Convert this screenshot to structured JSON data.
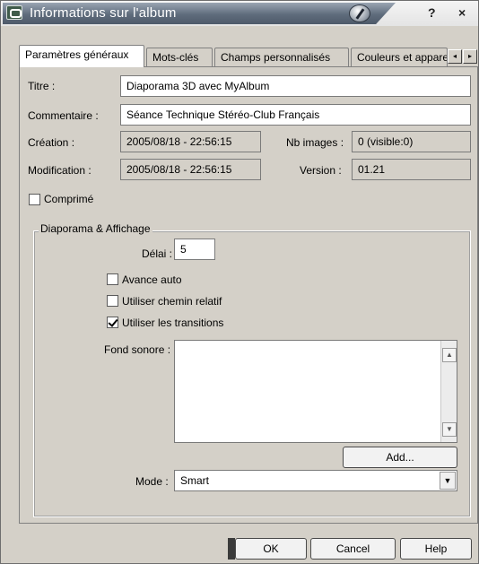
{
  "window": {
    "title": "Informations sur l'album",
    "help_glyph": "?",
    "close_glyph": "×"
  },
  "tabs": [
    {
      "label": "Paramètres généraux",
      "active": true
    },
    {
      "label": "Mots-clés",
      "active": false
    },
    {
      "label": "Champs personnalisés",
      "active": false
    },
    {
      "label": "Couleurs et apparence",
      "active": false
    }
  ],
  "tab_scroll": {
    "left_glyph": "◂",
    "right_glyph": "▸"
  },
  "fields": {
    "titre": {
      "label": "Titre :",
      "value": "Diaporama 3D avec MyAlbum"
    },
    "commentaire": {
      "label": "Commentaire :",
      "value": "Séance Technique Stéréo-Club Français"
    },
    "creation": {
      "label": "Création :",
      "value": "2005/08/18 - 22:56:15"
    },
    "nb_images": {
      "label": "Nb images :",
      "value": "0 (visible:0)"
    },
    "modification": {
      "label": "Modification :",
      "value": "2005/08/18 - 22:56:15"
    },
    "version": {
      "label": "Version :",
      "value": "01.21"
    }
  },
  "compress": {
    "label": "Comprimé",
    "checked": false
  },
  "slideshow": {
    "group_label": "Diaporama & Affichage",
    "delay": {
      "label": "Délai :",
      "value": "5"
    },
    "options": [
      {
        "label": "Avance auto",
        "checked": false
      },
      {
        "label": "Utiliser chemin relatif",
        "checked": false
      },
      {
        "label": "Utiliser les transitions",
        "checked": true
      }
    ],
    "sound": {
      "label": "Fond sonore :",
      "value": ""
    },
    "add_button": "Add...",
    "mode": {
      "label": "Mode :",
      "value": "Smart"
    }
  },
  "footer": {
    "ok": "OK",
    "cancel": "Cancel",
    "help": "Help"
  },
  "scroll_glyphs": {
    "up": "▲",
    "down": "▼",
    "dropdown": "▼"
  }
}
